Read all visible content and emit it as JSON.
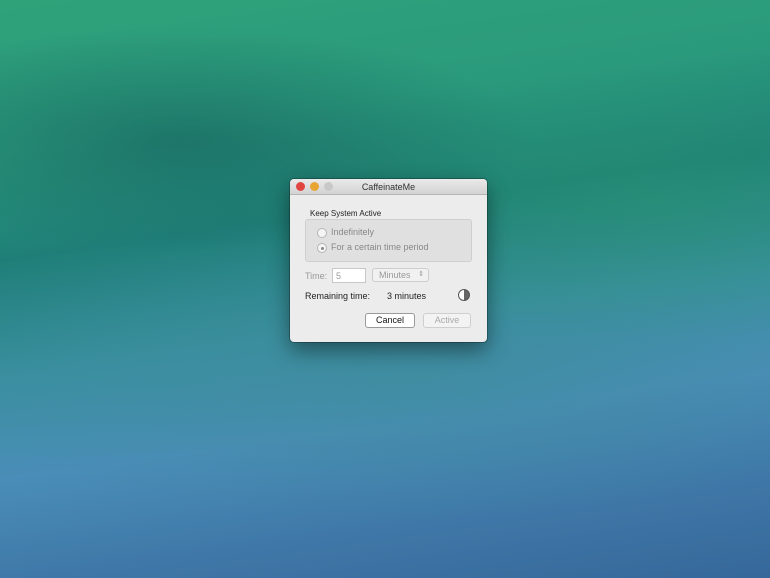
{
  "window": {
    "title": "CaffeinateMe"
  },
  "group": {
    "label": "Keep System Active",
    "options": [
      {
        "label": "Indefinitely",
        "selected": false
      },
      {
        "label": "For a certain time period",
        "selected": true
      }
    ]
  },
  "time": {
    "label": "Time:",
    "value": "5",
    "unit": "Minutes"
  },
  "remaining": {
    "label": "Remaining time:",
    "value": "3 minutes"
  },
  "buttons": {
    "cancel": "Cancel",
    "active": "Active"
  },
  "colors": {
    "close": "#e0463f",
    "minimize": "#e9a532",
    "zoom": "#c8c8c8"
  }
}
